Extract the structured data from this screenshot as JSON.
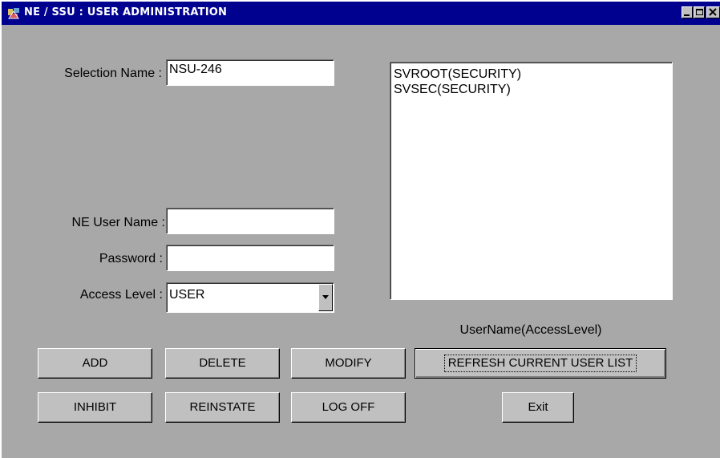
{
  "window": {
    "title": "NE / SSU : USER ADMINISTRATION"
  },
  "form": {
    "selection_label": "Selection Name :",
    "selection_value": "NSU-246",
    "username_label": "NE User Name  :",
    "username_value": "",
    "password_label": "Password :",
    "password_value": "",
    "access_label": "Access Level :",
    "access_value": "USER"
  },
  "user_list": {
    "items": [
      "SVROOT(SECURITY)",
      "SVSEC(SECURITY)"
    ],
    "caption": "UserName(AccessLevel)"
  },
  "buttons": {
    "add": "ADD",
    "delete": "DELETE",
    "modify": "MODIFY",
    "refresh": "REFRESH CURRENT USER LIST",
    "inhibit": "INHIBIT",
    "reinstate": "REINSTATE",
    "logoff": "LOG OFF",
    "exit": "Exit"
  },
  "colors": {
    "titlebar": "#01018f",
    "window_bg": "#a8a8a8",
    "button_face": "#c0c0c0"
  }
}
